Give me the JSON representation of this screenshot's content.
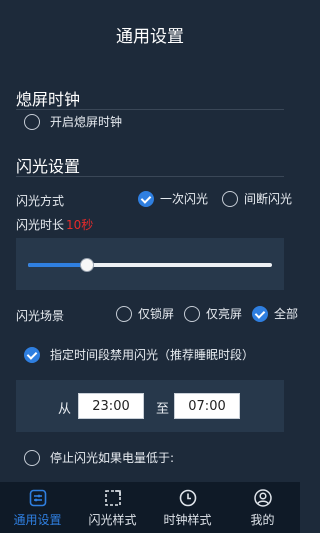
{
  "header": {
    "title": "通用设置"
  },
  "screen_off_clock": {
    "heading": "熄屏时钟",
    "enable_label": "开启熄屏时钟",
    "enabled": false
  },
  "flash": {
    "heading": "闪光设置",
    "mode_label": "闪光方式",
    "mode_options": [
      "一次闪光",
      "间断闪光"
    ],
    "mode_selected": "一次闪光",
    "duration_label": "闪光时长",
    "duration_value": "10秒",
    "duration_slider_fraction": 0.24,
    "scene_label": "闪光场景",
    "scene_options": [
      "仅锁屏",
      "仅亮屏",
      "全部"
    ],
    "scene_selected": "全部",
    "disable_period_label": "指定时间段禁用闪光（推荐睡眠时段）",
    "disable_period_enabled": true,
    "from_label": "从",
    "from_time": "23:00",
    "to_label": "至",
    "to_time": "07:00",
    "battery_label": "停止闪光如果电量低于:",
    "battery_enabled": false
  },
  "nav": {
    "items": [
      "通用设置",
      "闪光样式",
      "时钟样式",
      "我的"
    ],
    "active": "通用设置"
  },
  "colors": {
    "accent": "#2f7fe0",
    "background": "#1d2a3a",
    "highlight_red": "#e32b2b"
  }
}
